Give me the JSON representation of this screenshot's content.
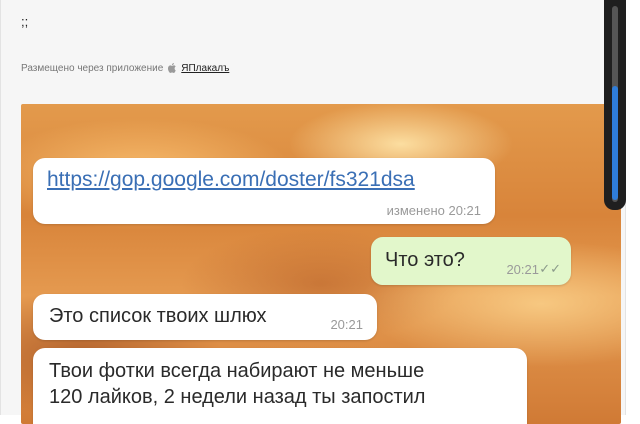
{
  "post": {
    "text": ";;",
    "posted_via_label": "Размещено через приложение",
    "app_link": "ЯПлакалъ"
  },
  "chat": {
    "message1": {
      "link": "https://gop.google.com/doster/fs321dsa",
      "meta": "изменено 20:21"
    },
    "message2": {
      "text": "Что это?",
      "time": "20:21"
    },
    "message3": {
      "text": "Это список твоих шлюх",
      "time": "20:21"
    },
    "message4": {
      "line1": "Твои фотки всегда набирают не меньше",
      "line2": "120 лайков, 2 недели назад ты запостил"
    }
  },
  "icons": {
    "apple": "apple-icon",
    "read_ticks": "double-check-icon"
  },
  "colors": {
    "incoming_bubble": "#ffffff",
    "outgoing_bubble": "#e2f7cb",
    "scroll_thumb": "#2f7dd9"
  }
}
